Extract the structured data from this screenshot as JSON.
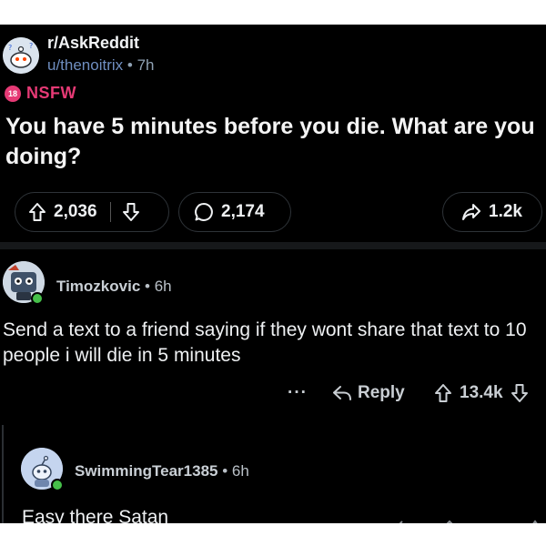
{
  "post": {
    "subreddit": "r/AskReddit",
    "username": "u/thenoitrix",
    "sep": "•",
    "age": "7h",
    "nsfw_badge": "18",
    "nsfw_label": "NSFW",
    "title": "You have 5 minutes before you die. What are you doing?",
    "score": "2,036",
    "comments": "2,174",
    "shares": "1.2k"
  },
  "comment": {
    "author": "Timozkovic",
    "sep": "•",
    "age": "6h",
    "text": "Send a text to a friend saying if they wont share that text to 10 people i will die in 5 minutes",
    "more": "···",
    "reply_label": "Reply",
    "score": "13.4k"
  },
  "reply": {
    "author": "SwimmingTear1385",
    "sep": "•",
    "age": "6h",
    "text": "Easy there Satan"
  },
  "colors": {
    "background": "#000000",
    "nsfw": "#e63a75",
    "online": "#46c04a",
    "username": "#6f8ec0"
  },
  "icons": [
    "snoo-subreddit-icon",
    "upvote-icon",
    "downvote-icon",
    "comment-bubble-icon",
    "share-icon",
    "reply-arrow-icon"
  ]
}
